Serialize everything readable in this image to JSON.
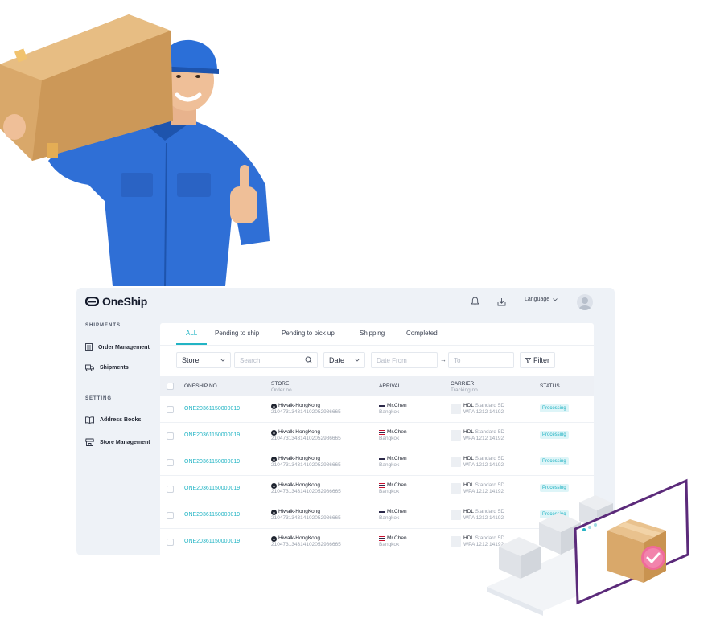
{
  "brand": {
    "name": "OneShip"
  },
  "topbar": {
    "language_label": "Language"
  },
  "sidebar": {
    "shipments_heading": "SHIPMENTS",
    "setting_heading": "SETTING",
    "items": [
      {
        "label": "Order Management",
        "icon": "document-icon"
      },
      {
        "label": "Shipments",
        "icon": "truck-icon"
      },
      {
        "label": "Address Books",
        "icon": "book-icon"
      },
      {
        "label": "Store Management",
        "icon": "store-icon"
      }
    ]
  },
  "tabs": [
    "ALL",
    "Pending to ship",
    "Pending to pick up",
    "Shipping",
    "Completed"
  ],
  "active_tab": "ALL",
  "filters": {
    "store": "Store",
    "search_placeholder": "Search",
    "date": "Date",
    "date_from_placeholder": "Date From",
    "arrow": "→",
    "to_placeholder": "To",
    "filter_label": "Filter"
  },
  "table": {
    "headers": {
      "oneship": "ONESHIP NO.",
      "store": "STORE",
      "store_sub": "Order no.",
      "arrival": "ARRIVAL",
      "carrier": "CARRIER",
      "carrier_sub": "Tracking no.",
      "status": "STATUS"
    },
    "rows": [
      {
        "oneship_no": "ONE20361150000019",
        "store": "Hiwalk-HongKong",
        "order_no": "210473134314102052986665",
        "name": "Mr.Chen",
        "city": "Bangkok",
        "carrier": "HDL",
        "service": "Standard 5D",
        "tracking": "WPA 1212 14192",
        "status": "Processing"
      },
      {
        "oneship_no": "ONE20361150000019",
        "store": "Hiwalk-HongKong",
        "order_no": "210473134314102052986665",
        "name": "Mr.Chen",
        "city": "Bangkok",
        "carrier": "HDL",
        "service": "Standard 5D",
        "tracking": "WPA 1212 14192",
        "status": "Processing"
      },
      {
        "oneship_no": "ONE20361150000019",
        "store": "Hiwalk-HongKong",
        "order_no": "210473134314102052986665",
        "name": "Mr.Chen",
        "city": "Bangkok",
        "carrier": "HDL",
        "service": "Standard 5D",
        "tracking": "WPA 1212 14192",
        "status": "Processing"
      },
      {
        "oneship_no": "ONE20361150000019",
        "store": "Hiwalk-HongKong",
        "order_no": "210473134314102052986665",
        "name": "Mr.Chen",
        "city": "Bangkok",
        "carrier": "HDL",
        "service": "Standard 5D",
        "tracking": "WPA 1212 14192",
        "status": "Processing"
      },
      {
        "oneship_no": "ONE20361150000019",
        "store": "Hiwalk-HongKong",
        "order_no": "210473134314102052986665",
        "name": "Mr.Chen",
        "city": "Bangkok",
        "carrier": "HDL",
        "service": "Standard 5D",
        "tracking": "WPA 1212 14192",
        "status": "Processing"
      },
      {
        "oneship_no": "ONE20361150000019",
        "store": "Hiwalk-HongKong",
        "order_no": "210473134314102052986665",
        "name": "Mr.Chen",
        "city": "Bangkok",
        "carrier": "HDL",
        "service": "Standard 5D",
        "tracking": "WPA 1212 14192",
        "status": ""
      }
    ]
  },
  "colors": {
    "accent": "#22b4c4",
    "app_background": "#eef2f7",
    "status_badge_bg": "#def5f8",
    "uniform_blue": "#2f6fd6",
    "cardboard": "#d9a86a",
    "browser_frame": "#5b2a7a",
    "check_badge": "#f06a9a"
  }
}
